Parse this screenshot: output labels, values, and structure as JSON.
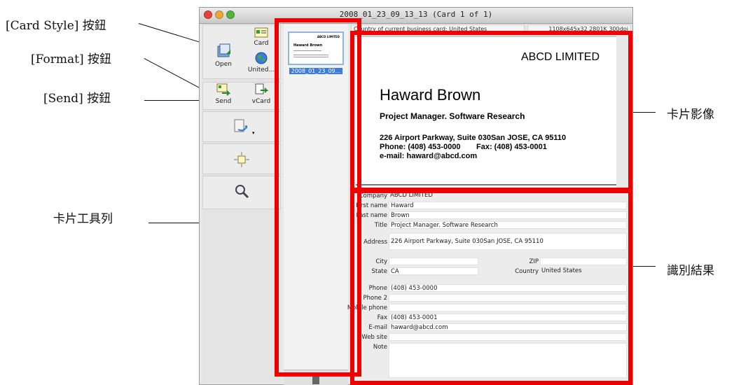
{
  "window": {
    "title": "2008_01_23_09_13_13 (Card 1 of 1)"
  },
  "toolbar": {
    "open_label": "Open",
    "card_label": "Card",
    "united_label": "United...",
    "send_label": "Send",
    "vcard_label": "vCard"
  },
  "thumbnail": {
    "caption": "2008_01_23_09...",
    "mini_company": "ABCD LIMITED",
    "mini_name": "Haward Brown"
  },
  "header": {
    "country_info": "Country of current business card: United States",
    "image_info": "1108x645x32  2801K  300dpi"
  },
  "card": {
    "company": "ABCD LIMITED",
    "name": "Haward Brown",
    "title": "Project Manager. Software Research",
    "address": "226 Airport Parkway, Suite 030San JOSE, CA 95110",
    "phone_line": "Phone: (408) 453-0000",
    "fax_line": "Fax: (408) 453-0001",
    "email_line": "e-mail: haward@abcd.com"
  },
  "form": {
    "labels": {
      "company": "Company",
      "first_name": "First name",
      "last_name": "Last name",
      "title": "Title",
      "address": "Address",
      "city": "City",
      "zip": "ZIP",
      "state": "State",
      "country": "Country",
      "phone": "Phone",
      "phone2": "Phone 2",
      "mobile": "Mobile phone",
      "fax": "Fax",
      "email": "E-mail",
      "website": "Web site",
      "note": "Note"
    },
    "values": {
      "company": "ABCD LIMITED",
      "first_name": "Haward",
      "last_name": "Brown",
      "title": "Project Manager. Software Research",
      "address": "226 Airport Parkway, Suite 030San JOSE, CA 95110",
      "city": "",
      "zip": "",
      "state": "CA",
      "country": "United States",
      "phone": "(408) 453-0000",
      "phone2": "",
      "mobile": "",
      "fax": "(408) 453-0001",
      "email": "haward@abcd.com",
      "website": "",
      "note": ""
    }
  },
  "callouts": {
    "card_style": "[Card Style] 按鈕",
    "format": "[Format] 按鈕",
    "send": "[Send] 按鈕",
    "toolbar": "卡片工具列",
    "card_image": "卡片影像",
    "recognition": "識別結果"
  },
  "colors": {
    "highlight": "#ee0000"
  }
}
